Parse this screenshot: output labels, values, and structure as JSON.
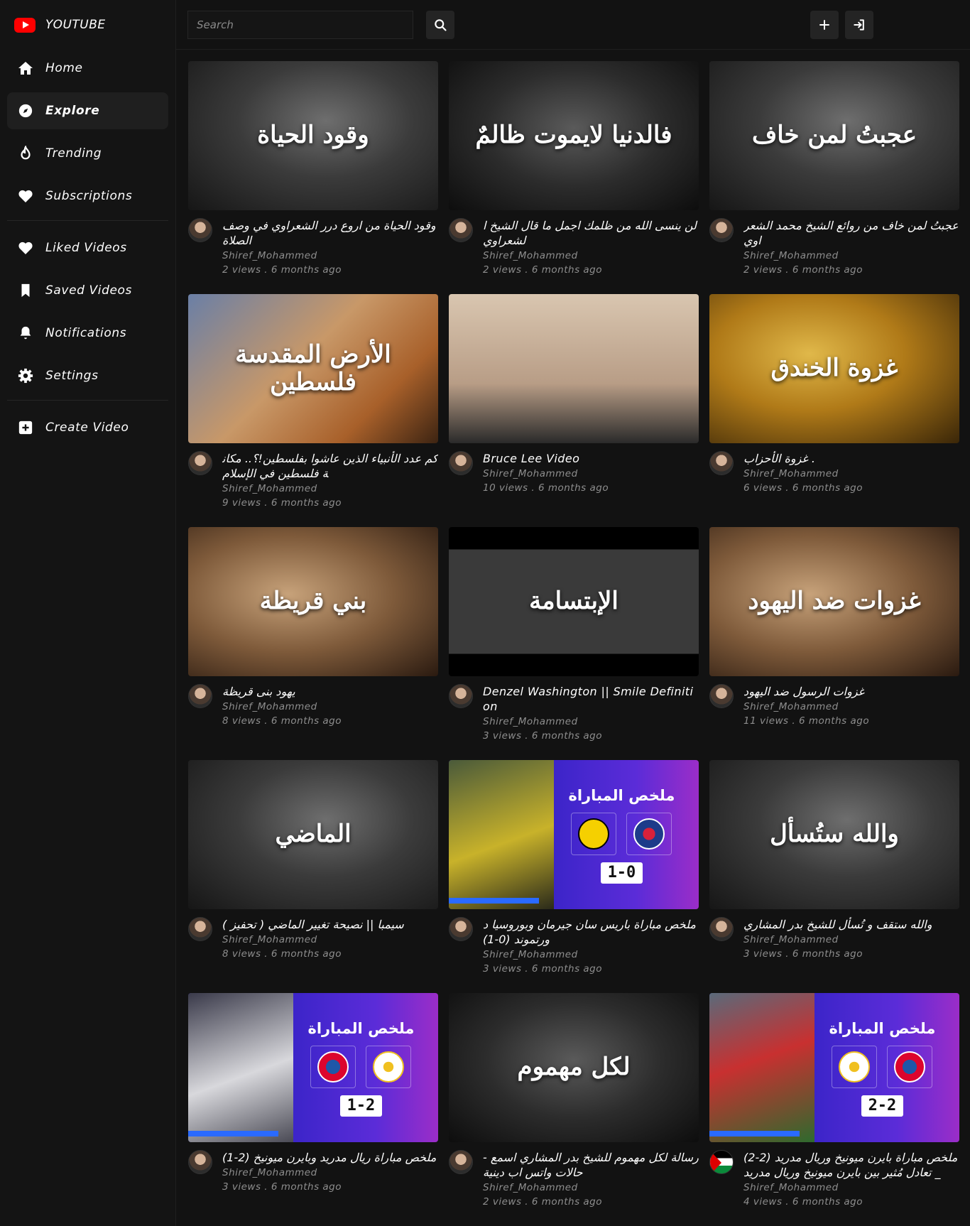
{
  "brand": {
    "name": "YOUTUBE"
  },
  "search": {
    "placeholder": "Search"
  },
  "sidebar": {
    "items": [
      {
        "label": "Home",
        "icon": "home-icon"
      },
      {
        "label": "Explore",
        "icon": "compass-icon",
        "active": true
      },
      {
        "label": "Trending",
        "icon": "fire-icon"
      },
      {
        "label": "Subscriptions",
        "icon": "heart-icon"
      }
    ],
    "items2": [
      {
        "label": "Liked Videos",
        "icon": "heart-icon"
      },
      {
        "label": "Saved Videos",
        "icon": "bookmark-icon"
      },
      {
        "label": "Notifications",
        "icon": "bell-icon"
      },
      {
        "label": "Settings",
        "icon": "gear-icon"
      }
    ],
    "items3": [
      {
        "label": "Create Video",
        "icon": "plus-square-icon"
      }
    ]
  },
  "videos": [
    {
      "title": "وقود الحياة من اروع درر الشعراوي في وصف الصلاة",
      "thumb_text": "وقود الحياة",
      "style": "bw",
      "channel": "Shiref_Mohammed",
      "stats": "2 views . 6 months ago"
    },
    {
      "title": "لن ينسى الله من ظلمك اجمل ما قال الشيخ الشعراوي",
      "thumb_text": "فالدنيا لايموت ظالمٌ",
      "style": "bw-dark",
      "channel": "Shiref_Mohammed",
      "stats": "2 views . 6 months ago"
    },
    {
      "title": "عجبتُ لمن خاف من روائع الشيخ محمد الشعراوي",
      "thumb_text": "عجبتُ لمن خاف",
      "style": "bw",
      "channel": "Shiref_Mohammed",
      "stats": "2 views . 6 months ago"
    },
    {
      "title": "كم عدد الأنبياء الذين عاشوا بفلسطين!؟.. مكانة فلسطين في الإسلام",
      "thumb_text": "الأرض المقدسة فلسطين",
      "style": "desert",
      "channel": "Shiref_Mohammed",
      "stats": "9 views . 6 months ago"
    },
    {
      "title": "Bruce Lee Video",
      "thumb_text": "",
      "style": "bruce",
      "channel": "Shiref_Mohammed",
      "stats": "10 views . 6 months ago"
    },
    {
      "title": "غزوة الأحزاب .",
      "thumb_text": "غزوة الخندق",
      "style": "gold",
      "channel": "Shiref_Mohammed",
      "stats": "6 views . 6 months ago"
    },
    {
      "title": "يهود بنى قريظة",
      "thumb_text": "بني قريظة",
      "style": "warm",
      "channel": "Shiref_Mohammed",
      "stats": "8 views . 6 months ago"
    },
    {
      "title": "Denzel Washington || Smile Definition",
      "thumb_text": "الإبتسامة",
      "style": "smile",
      "channel": "Shiref_Mohammed",
      "stats": "3 views . 6 months ago"
    },
    {
      "title": "غزوات الرسول ضد اليهود",
      "thumb_text": "غزوات ضد اليهود",
      "style": "warm",
      "channel": "Shiref_Mohammed",
      "stats": "11 views . 6 months ago"
    },
    {
      "title": "سيمبا || نصيحة تغيير الماضي ( تحفيز )",
      "thumb_text": "الماضي",
      "style": "bw",
      "channel": "Shiref_Mohammed",
      "stats": "8 views . 6 months ago"
    },
    {
      "title": "ملخص مباراة باريس سان جيرمان وبوروسيا دورتموند (0-1)",
      "thumb_text": "",
      "style": "ucl",
      "ucl": {
        "photo": "yellow",
        "head": "ملخص المباراة",
        "crests": [
          "bvb",
          "psg"
        ],
        "score": "1-0"
      },
      "channel": "Shiref_Mohammed",
      "stats": "3 views . 6 months ago"
    },
    {
      "title": "والله ستقف و تُسأل للشيخ بدر المشاري",
      "thumb_text": "والله ستُسأل",
      "style": "bw",
      "channel": "Shiref_Mohammed",
      "stats": "3 views . 6 months ago"
    },
    {
      "title": "ملخص مباراة ريال مدريد وبايرن ميونيخ (2-1)",
      "thumb_text": "",
      "style": "ucl",
      "ucl": {
        "photo": "white",
        "head": "ملخص المباراة",
        "crests": [
          "bay",
          "rm"
        ],
        "score": "1-2"
      },
      "channel": "Shiref_Mohammed",
      "stats": "3 views . 6 months ago"
    },
    {
      "title": "رسالة لكل مهموم للشيخ بدر المشاري اسمع - حالات واتس اب دينية",
      "thumb_text": "لكل مهموم",
      "style": "bw-dark",
      "channel": "Shiref_Mohammed",
      "stats": "2 views . 6 months ago"
    },
    {
      "title": "ملخص مباراة بايرن ميونيخ وريال مدريد (2-2) _ تعادل مُثير بين بايرن ميونيخ وريال مدريد",
      "thumb_text": "",
      "style": "ucl",
      "ucl": {
        "photo": "red",
        "head": "ملخص المباراة",
        "crests": [
          "rm",
          "bay"
        ],
        "score": "2-2"
      },
      "channel": "Shiref_Mohammed",
      "stats": "4 views . 6 months ago",
      "avatar": "flag"
    }
  ]
}
